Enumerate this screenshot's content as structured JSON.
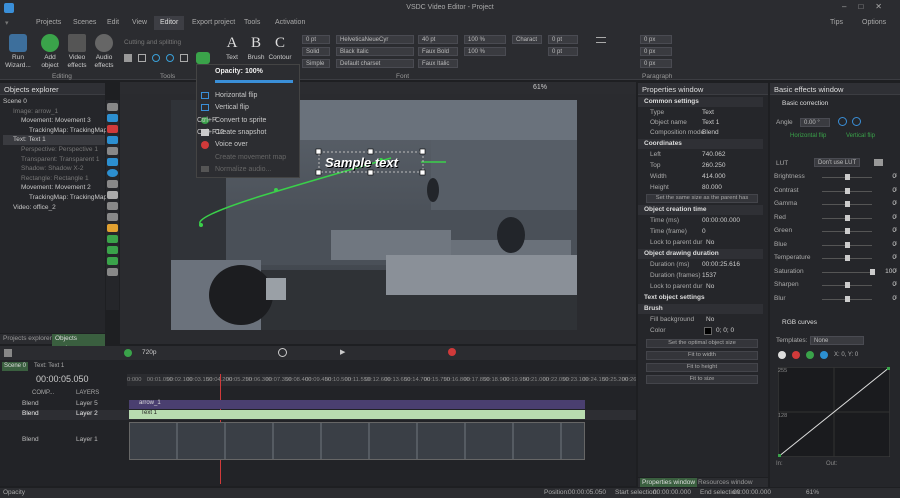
{
  "window": {
    "title": "VSDC Video Editor - Project",
    "tip": "Tips",
    "options": "Options"
  },
  "menu": [
    "Projects",
    "Scenes",
    "Edit",
    "View",
    "Editor",
    "Export project",
    "Tools",
    "Activation"
  ],
  "ribbon": {
    "run_wizard": "Run Wizard...",
    "add_object": "Add object",
    "video_effects": "Video effects",
    "audio_effects": "Audio effects",
    "cutting": "Cutting and splitting",
    "font_name": "HelveticaNeueCyr",
    "font_size": "40 pt",
    "font_style": "Black Italic",
    "font_bold": "Faux Bold",
    "font_italic": "Faux Italic",
    "charset": "Default charset",
    "line_solid": "Solid",
    "simple": "Simple",
    "zero_pt": "0 pt",
    "pct100": "100 %",
    "charact": "Charact",
    "px0": "0 px",
    "text_btn": "Text",
    "brush_btn": "Brush",
    "contour_btn": "Contour",
    "groups": {
      "editing": "Editing",
      "tools": "Tools",
      "font": "Font",
      "paragraph": "Paragraph"
    }
  },
  "dropdown": {
    "opacity": "Opacity: 100%",
    "items": [
      "Horizontal flip",
      "Vertical flip",
      "Convert to sprite",
      "Create snapshot",
      "Voice over",
      "Create movement map",
      "Normalize audio..."
    ],
    "shortcuts": [
      "",
      "",
      "Ctrl+P",
      "Ctrl+F12",
      "",
      "",
      ""
    ]
  },
  "objects_explorer": {
    "title": "Objects explorer",
    "tree": [
      "Scene 0",
      "Image: arrow_1",
      "Movement: Movement 3",
      "TrackingMap: TrackingMap",
      "Text: Text 1",
      "Perspective: Perspective 1",
      "Transparent: Transparent 1",
      "Shadow: Shadow X-2",
      "Rectangle: Rectangle 1",
      "Movement: Movement 2",
      "TrackingMap: TrackingMap",
      "Video: office_2"
    ],
    "tabs": [
      "Projects explorer",
      "Objects explorer"
    ]
  },
  "canvas": {
    "sample_text": "Sample text",
    "zoom": "61%"
  },
  "properties": {
    "title": "Properties window",
    "common": "Common settings",
    "type_k": "Type",
    "type_v": "Text",
    "object_name_k": "Object name",
    "object_name_v": "Text 1",
    "comp_k": "Composition mode",
    "comp_v": "Blend",
    "coords": "Coordinates",
    "left_k": "Left",
    "left_v": "740.062",
    "top_k": "Top",
    "top_v": "260.250",
    "width_k": "Width",
    "width_v": "414.000",
    "height_k": "Height",
    "height_v": "80.000",
    "same_size": "Set the same size as the parent has",
    "creation": "Object creation time",
    "time_ms_k": "Time (ms)",
    "time_ms_v": "00:00:00.000",
    "time_fr_k": "Time (frame)",
    "time_fr_v": "0",
    "lock_k": "Lock to parent dur",
    "lock_v": "No",
    "duration": "Object drawing duration",
    "dur_ms_k": "Duration (ms)",
    "dur_ms_v": "00:00:25.616",
    "dur_fr_k": "Duration (frames)",
    "dur_fr_v": "1537",
    "lock2_k": "Lock to parent dur",
    "lock2_v": "No",
    "text_obj": "Text object settings",
    "brush": "Brush",
    "fill_k": "Fill background",
    "fill_v": "No",
    "color_k": "Color",
    "color_v": "0; 0; 0",
    "optimal": "Set the optimal object size",
    "fit_width": "Fit to width",
    "fit_height": "Fit to height",
    "fit_size": "Fit to size",
    "tabs": [
      "Properties window",
      "Resources window"
    ]
  },
  "effects": {
    "title": "Basic effects window",
    "basic": "Basic correction",
    "angle_k": "Angle",
    "angle_v": "0.00 °",
    "hflip": "Horizontal flip",
    "vflip": "Vertical flip",
    "lut_k": "LUT",
    "lut_v": "Don't use LUT",
    "sliders": [
      {
        "k": "Brightness",
        "v": "0",
        "f": 0.5
      },
      {
        "k": "Contrast",
        "v": "0",
        "f": 0.5
      },
      {
        "k": "Gamma",
        "v": "0",
        "f": 0.5
      },
      {
        "k": "Red",
        "v": "0",
        "f": 0.5
      },
      {
        "k": "Green",
        "v": "0",
        "f": 0.5
      },
      {
        "k": "Blue",
        "v": "0",
        "f": 0.5
      },
      {
        "k": "Temperature",
        "v": "0",
        "f": 0.5
      },
      {
        "k": "Saturation",
        "v": "100",
        "f": 1
      },
      {
        "k": "Sharpen",
        "v": "0",
        "f": 0.5
      },
      {
        "k": "Blur",
        "v": "0",
        "f": 0.5
      }
    ],
    "rgb": "RGB curves",
    "templates_k": "Templates:",
    "templates_v": "None",
    "xy": "X: 0, Y: 0",
    "c255": "255",
    "c128": "128",
    "in_k": "In:",
    "out_k": "Out:"
  },
  "timeline": {
    "tabs": [
      "Scene 0",
      "Text: Text 1"
    ],
    "time": "00:00:05.050",
    "res": "720p",
    "comp": "COMP...",
    "layers": "LAYERS",
    "ticks": [
      "0:000",
      "00:01.050",
      "00:02.100",
      "00:03.150",
      "00:04.200",
      "00:05.250",
      "00:06.300",
      "00:07.350",
      "00:08.400",
      "00:09.450",
      "00:10.500",
      "00:11.550",
      "00:12.600",
      "00:13.650",
      "00:14.700",
      "00:15.750",
      "00:16.800",
      "00:17.850",
      "00:18.900",
      "00:19.950",
      "00:21.000",
      "00:22.050",
      "00:23.100",
      "00:24.150",
      "00:25.200",
      "00:26.250",
      "00:27.300"
    ],
    "rows": [
      {
        "blend": "Blend",
        "layer": "Layer 5",
        "clip": "arrow_1"
      },
      {
        "blend": "Blend",
        "layer": "Layer 2",
        "clip": "Text 1"
      },
      {
        "blend": "Blend",
        "layer": "Layer 1",
        "clip": ""
      }
    ]
  },
  "status": {
    "left": "Opacity",
    "position": "Position:",
    "position_v": "00:00:05.050",
    "start": "Start selection:",
    "start_v": "00:00:00.000",
    "end": "End selection:",
    "end_v": "00:00:00.000",
    "zoom": "61%"
  }
}
